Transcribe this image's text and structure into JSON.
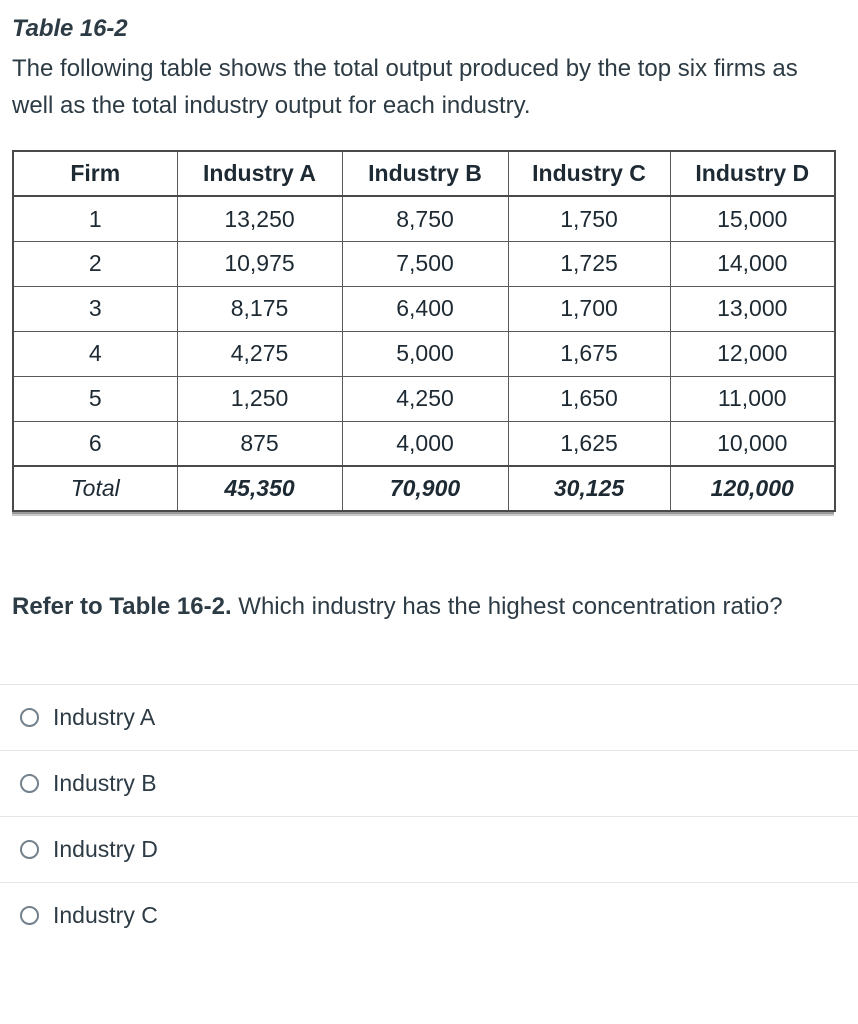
{
  "intro": {
    "table_label": "Table 16-2",
    "description": "The following table shows the total output produced by the top six firms as well as the total industry output for each industry."
  },
  "table": {
    "columns": [
      "Firm",
      "Industry A",
      "Industry B",
      "Industry C",
      "Industry D"
    ],
    "rows": [
      {
        "firm": "1",
        "a": "13,250",
        "b": "8,750",
        "c": "1,750",
        "d": "15,000"
      },
      {
        "firm": "2",
        "a": "10,975",
        "b": "7,500",
        "c": "1,725",
        "d": "14,000"
      },
      {
        "firm": "3",
        "a": "8,175",
        "b": "6,400",
        "c": "1,700",
        "d": "13,000"
      },
      {
        "firm": "4",
        "a": "4,275",
        "b": "5,000",
        "c": "1,675",
        "d": "12,000"
      },
      {
        "firm": "5",
        "a": "1,250",
        "b": "4,250",
        "c": "1,650",
        "d": "11,000"
      },
      {
        "firm": "6",
        "a": "875",
        "b": "4,000",
        "c": "1,625",
        "d": "10,000"
      }
    ],
    "total": {
      "firm": "Total",
      "a": "45,350",
      "b": "70,900",
      "c": "30,125",
      "d": "120,000"
    }
  },
  "question": {
    "lead": "Refer to Table 16-2.",
    "text": " Which industry has the highest concentration ratio?"
  },
  "options": [
    {
      "label": "Industry A",
      "selected": false
    },
    {
      "label": "Industry B",
      "selected": false
    },
    {
      "label": "Industry D",
      "selected": false
    },
    {
      "label": "Industry C",
      "selected": false
    }
  ],
  "colors": {
    "text": "#2d3b45",
    "table_border": "#4a4a4a",
    "cell_border": "#5a5a5a",
    "radio_outline": "#73818c",
    "separator": "#e3e5e7"
  }
}
